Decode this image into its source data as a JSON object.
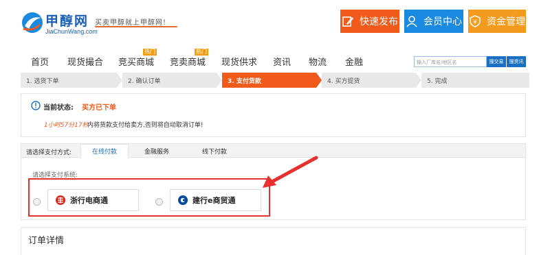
{
  "header": {
    "logo_cn": "甲醇网",
    "logo_en": "JiaChunWang.com",
    "slogan": "买卖甲醇就上甲醇网!",
    "buttons": {
      "publish": "快速发布",
      "member": "会员中心",
      "fund": "资金管理"
    }
  },
  "nav": {
    "items": [
      {
        "label": "首页"
      },
      {
        "label": "现货撮合"
      },
      {
        "label": "竞买商城",
        "badge": "热门"
      },
      {
        "label": "竞卖商城",
        "badge": "热门"
      },
      {
        "label": "现货供求"
      },
      {
        "label": "资讯"
      },
      {
        "label": "物流"
      },
      {
        "label": "金融"
      }
    ],
    "search_placeholder": "输入厂库名/地区名",
    "search_trade": "搜交易",
    "search_news": "搜资讯"
  },
  "steps": [
    {
      "label": "1. 选货下单"
    },
    {
      "label": "2. 确认订单"
    },
    {
      "label": "3. 支付货款"
    },
    {
      "label": "4. 买方提货"
    },
    {
      "label": "5. 完成"
    }
  ],
  "status": {
    "label": "当前状态:",
    "value": "买方已下单",
    "countdown": "1小时57分17秒",
    "message": "内将货款支付给卖方,否则将自动取消订单!"
  },
  "payment": {
    "label": "请选择支付方式:",
    "tabs": {
      "online": "在线付款",
      "finance": "金融服务",
      "offline": "线下付款"
    },
    "pick_label": "请选择支付系统:",
    "options": {
      "zheshang": "浙行电商通",
      "ccb": "建行e商贸通"
    }
  },
  "order": {
    "title": "订单详情"
  },
  "colors": {
    "brand_blue": "#1a5fb4",
    "accent_orange": "#f05a1a",
    "member_blue": "#1a8ae0",
    "fund_orange": "#f49b1e",
    "highlight_red": "#e8312f"
  }
}
